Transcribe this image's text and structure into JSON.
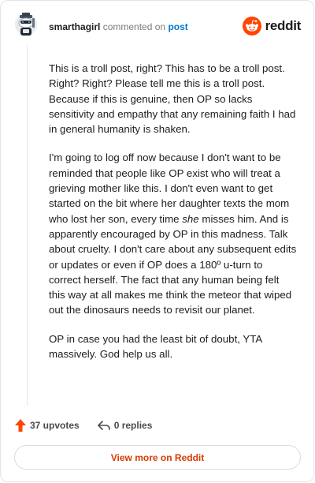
{
  "header": {
    "username": "smarthagirl",
    "commented_on": "commented on",
    "post_link": "post",
    "brand": "reddit"
  },
  "comment": {
    "paragraphs": [
      {
        "segments": [
          "This is a troll post, right? This has to be a troll post. Right? Right? Please tell me this is a troll post. Because if this is genuine, then OP so lacks sensitivity and empathy that any remaining faith I had in general humanity is shaken."
        ]
      },
      {
        "segments": [
          "I'm going to log off now because I don't want to be reminded that people like OP exist who will treat a grieving mother like this. I don't even want to get started on the bit where her daughter texts the mom who lost her son, every time ",
          "she",
          " misses him. And is apparently encouraged by OP in this madness. Talk about cruelty. I don't care about any subsequent edits or updates or even if OP does a 180º u-turn to correct herself. The fact that any human being felt this way at all makes me think the meteor that wiped out the dinosaurs needs to revisit our planet."
        ]
      },
      {
        "segments": [
          "OP in case you had the least bit of doubt, YTA massively. God help us all."
        ]
      }
    ]
  },
  "footer": {
    "upvotes": "37 upvotes",
    "replies": "0 replies"
  },
  "view_more": "View more on Reddit",
  "colors": {
    "upvote_orange": "#ff4500",
    "link_blue": "#0079d3",
    "view_more_text": "#d93a00"
  },
  "icons": {
    "avatar": "snoo-avatar",
    "brand": "reddit-snoo-logo",
    "upvote": "upvote-arrow-icon",
    "reply": "reply-arrow-icon"
  }
}
